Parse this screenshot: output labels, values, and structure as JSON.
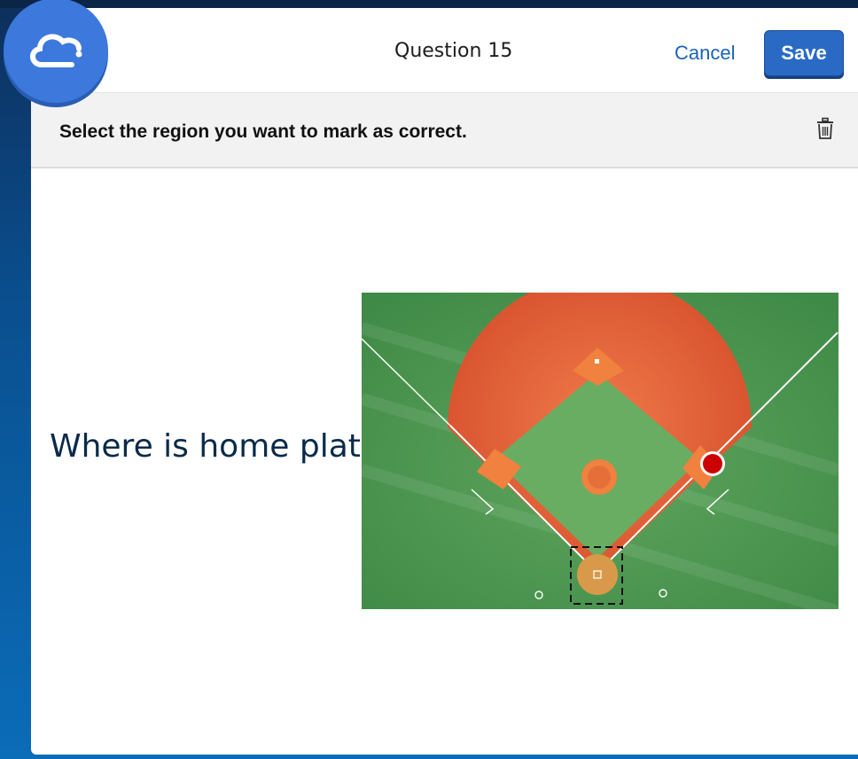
{
  "header": {
    "title": "Question 15",
    "cancel_label": "Cancel",
    "save_label": "Save"
  },
  "toolbar": {
    "instruction": "Select the region you want to mark as correct.",
    "delete_icon": "trash-icon"
  },
  "question": {
    "text": "Where is home plate?"
  },
  "image": {
    "subject": "baseball-field-aerial",
    "selection_region": "dashed-square-home-plate",
    "marker": "red-dot-marker"
  },
  "colors": {
    "accent": "#2a6ac4",
    "link": "#1a63b5",
    "marker": "#cc0000",
    "logo": "#3d78dc"
  }
}
